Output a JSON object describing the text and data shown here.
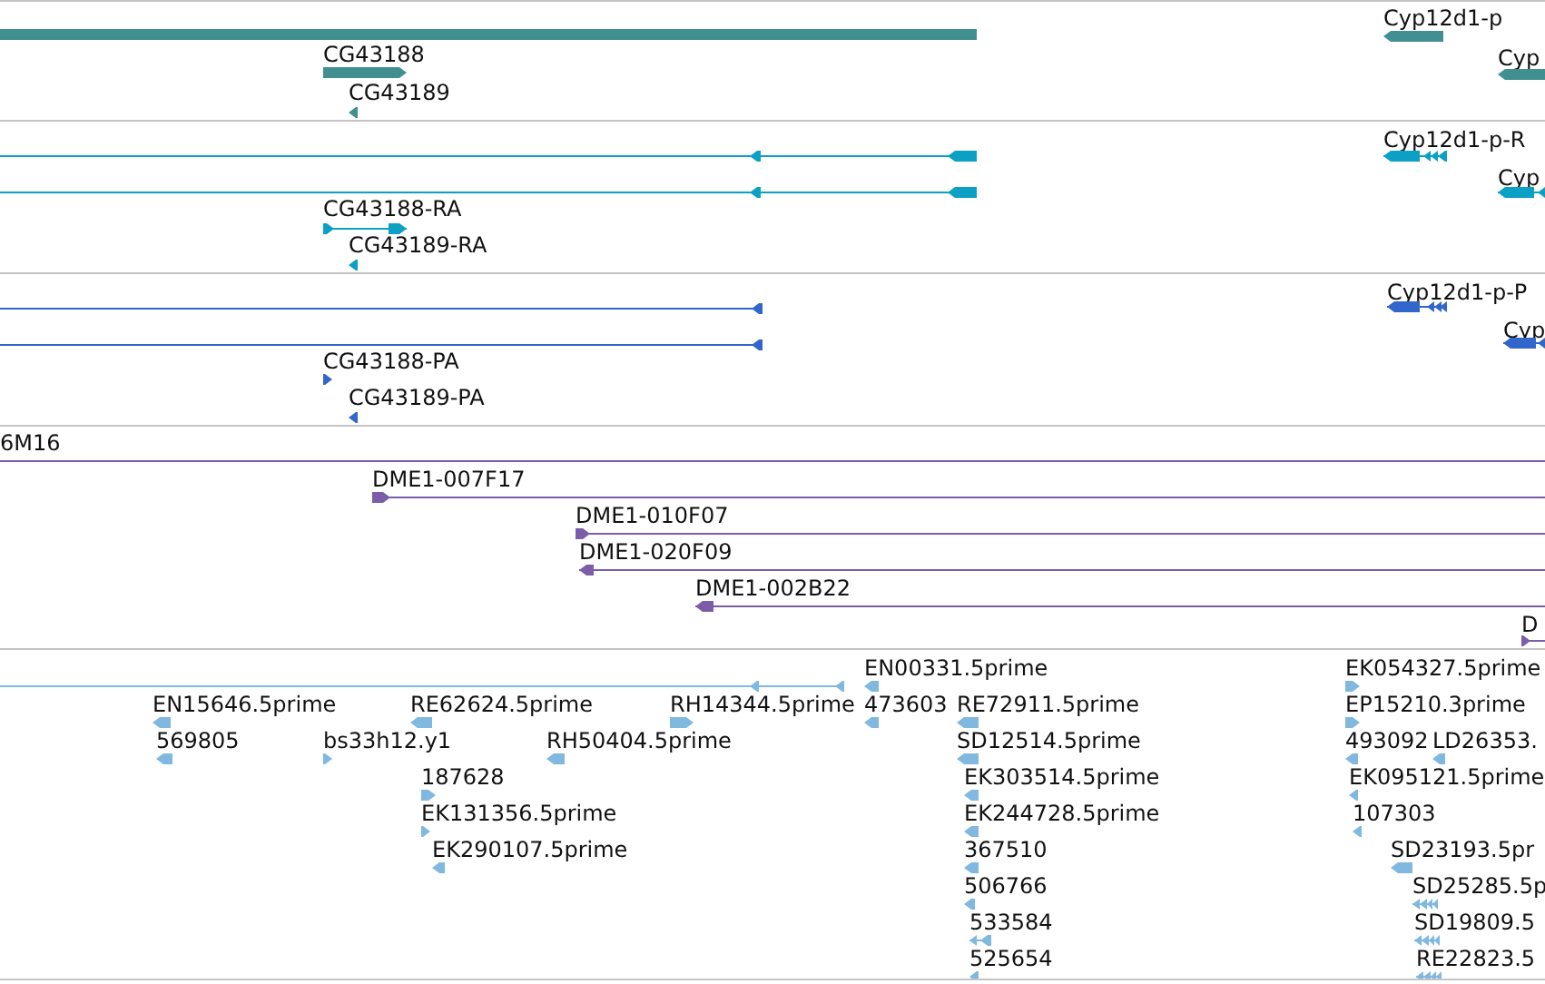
{
  "tracks": [
    {
      "color": "#428f91",
      "features": [
        {
          "kind": "bar"
        },
        {
          "kind": "bar",
          "label": "CG43188",
          "reverse": false
        },
        {
          "kind": "bar",
          "label": "CG43189",
          "reverse": true
        },
        {
          "kind": "bar",
          "label": "Cyp12d1-p",
          "reverse": true
        },
        {
          "kind": "bar",
          "label": "Cyp",
          "reverse": true
        }
      ]
    },
    {
      "color": "#0ba0c4",
      "features": [
        {
          "kind": "line",
          "reverse": true
        },
        {
          "kind": "line",
          "reverse": true
        },
        {
          "kind": "line",
          "label": "CG43188-RA",
          "reverse": false
        },
        {
          "kind": "bar",
          "label": "CG43189-RA",
          "reverse": true
        },
        {
          "kind": "line",
          "label": "Cyp12d1-p-R",
          "reverse": true
        },
        {
          "kind": "line",
          "label": "Cyp",
          "reverse": true
        }
      ]
    },
    {
      "color": "#3366cc",
      "features": [
        {
          "kind": "line",
          "reverse": true
        },
        {
          "kind": "line",
          "reverse": true
        },
        {
          "kind": "bar",
          "label": "CG43188-PA",
          "reverse": false
        },
        {
          "kind": "bar",
          "label": "CG43189-PA",
          "reverse": true
        },
        {
          "kind": "line",
          "label": "Cyp12d1-p-P",
          "reverse": true
        },
        {
          "kind": "line",
          "label": "Cyp",
          "reverse": true
        }
      ]
    },
    {
      "color": "#7b5ea7",
      "features": [
        {
          "kind": "line",
          "label": "6M16"
        },
        {
          "kind": "line",
          "label": "DME1-007F17",
          "reverse": false
        },
        {
          "kind": "line",
          "label": "DME1-010F07",
          "reverse": false
        },
        {
          "kind": "line",
          "label": "DME1-020F09",
          "reverse": true
        },
        {
          "kind": "line",
          "label": "DME1-002B22",
          "reverse": true
        },
        {
          "kind": "line",
          "label": "D",
          "reverse": false
        }
      ]
    },
    {
      "color": "#80b8e0",
      "features": [
        {
          "kind": "line",
          "reverse": true
        },
        {
          "kind": "bar",
          "label": "EN15646.5prime",
          "reverse": true
        },
        {
          "kind": "bar",
          "label": "569805",
          "reverse": true
        },
        {
          "kind": "bar",
          "label": "bs33h12.y1",
          "reverse": false
        },
        {
          "kind": "bar",
          "label": "RE62624.5prime",
          "reverse": true
        },
        {
          "kind": "bar",
          "label": "187628",
          "reverse": false
        },
        {
          "kind": "bar",
          "label": "EK131356.5prime",
          "reverse": false
        },
        {
          "kind": "bar",
          "label": "EK290107.5prime",
          "reverse": true
        },
        {
          "kind": "bar",
          "label": "RH50404.5prime",
          "reverse": true
        },
        {
          "kind": "bar",
          "label": "RH14344.5prime",
          "reverse": false
        },
        {
          "kind": "bar",
          "label": "EN00331.5prime",
          "reverse": true
        },
        {
          "kind": "bar",
          "label": "473603",
          "reverse": true
        },
        {
          "kind": "bar",
          "label": "RE72911.5prime",
          "reverse": true
        },
        {
          "kind": "bar",
          "label": "SD12514.5prime",
          "reverse": true
        },
        {
          "kind": "bar",
          "label": "EK303514.5prime",
          "reverse": true
        },
        {
          "kind": "bar",
          "label": "EK244728.5prime",
          "reverse": true
        },
        {
          "kind": "bar",
          "label": "367510",
          "reverse": true
        },
        {
          "kind": "bar",
          "label": "506766",
          "reverse": true
        },
        {
          "kind": "line",
          "label": "533584",
          "reverse": true
        },
        {
          "kind": "bar",
          "label": "525654",
          "reverse": true
        },
        {
          "kind": "bar",
          "label": "EK054327.5prime",
          "reverse": false
        },
        {
          "kind": "bar",
          "label": "EP15210.3prime",
          "reverse": false
        },
        {
          "kind": "bar",
          "label": "493092",
          "reverse": true
        },
        {
          "kind": "bar",
          "label": "LD26353.",
          "reverse": true
        },
        {
          "kind": "bar",
          "label": "EK095121.5prime",
          "reverse": true
        },
        {
          "kind": "bar",
          "label": "107303",
          "reverse": true
        },
        {
          "kind": "bar",
          "label": "SD23193.5pr",
          "reverse": true
        },
        {
          "kind": "line",
          "label": "SD25285.5p",
          "reverse": true
        },
        {
          "kind": "line",
          "label": "SD19809.5",
          "reverse": true
        },
        {
          "kind": "line",
          "label": "RE22823.5",
          "reverse": true
        }
      ]
    }
  ]
}
